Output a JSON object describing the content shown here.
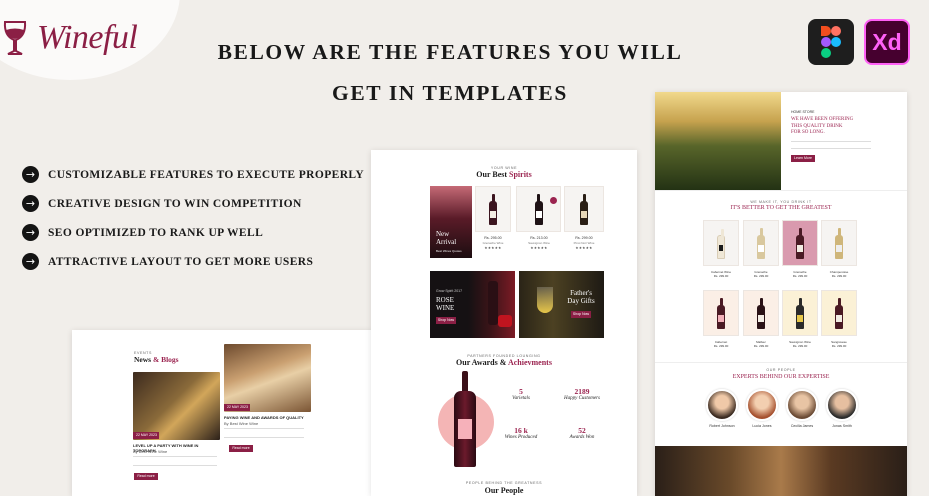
{
  "brand": {
    "name": "Wineful"
  },
  "headline": {
    "line1": "BELOW ARE THE FEATURES YOU WILL",
    "line2": "GET IN TEMPLATES"
  },
  "tools": [
    {
      "icon": "figma-icon"
    },
    {
      "label": "Xd",
      "icon": "adobe-xd-icon"
    }
  ],
  "features": [
    {
      "label": "CUSTOMIZABLE FEATURES TO EXECUTE PROPERLY"
    },
    {
      "label": "CREATIVE DESIGN TO WIN COMPETITION"
    },
    {
      "label": "SEO OPTIMIZED TO RANK UP WELL"
    },
    {
      "label": "ATTRACTIVE LAYOUT TO GET MORE USERS"
    }
  ],
  "colors": {
    "accent": "#8b1f45",
    "background": "#f1eeea",
    "xd_bg": "#46002f",
    "xd_fg": "#ff61f6"
  },
  "left_card": {
    "eyebrow": "EVENTS",
    "title_plain": "News ",
    "title_accent": "& Blogs",
    "blog1": {
      "date": "22 MAY 2023",
      "title": "LEVEL UP A PARTY WITH WINE IN TOPGRAPH",
      "meta": "By Best Wine Wine",
      "btn": "Read more"
    },
    "blog2": {
      "date": "22 MAY 2023",
      "title": "PAYING WINE AND AWARDS OF QUALITY",
      "meta": "By Best Wine Wine",
      "btn": "Read more"
    }
  },
  "center_card": {
    "eyebrow": "YOUR WINE",
    "title_plain": "Our Best ",
    "title_accent": "Spirits",
    "promo": {
      "line1": "New",
      "line2": "Arrival",
      "sub": "Best Wines Quotes"
    },
    "products": [
      {
        "price": "Rs. 295.00",
        "name": "Grenache Wine",
        "stars": "★★★★★"
      },
      {
        "price": "Rs. 213.00",
        "name": "Sauvignon Wine",
        "stars": "★★★★★"
      },
      {
        "price": "Rs. 299.00",
        "name": "Pinot Noir Wine",
        "stars": "★★★★★"
      }
    ],
    "banner1": {
      "eyebrow": "Grow Spirit 2017",
      "line1": "ROSE",
      "line2": "WINE",
      "btn": "Shop Now"
    },
    "banner2": {
      "line1": "Father's",
      "line2": "Day Gifts",
      "btn": "Shop Now"
    },
    "awards": {
      "eyebrow": "PARTNERS FOUNDED LOUNGING",
      "title_plain": "Our Awards & ",
      "title_accent": "Achievments",
      "stats": [
        {
          "num": "5",
          "label": "Varietals"
        },
        {
          "num": "2189",
          "label": "Happy Customers"
        },
        {
          "num": "16 k",
          "label": "Wines Produced"
        },
        {
          "num": "52",
          "label": "Awards Won"
        }
      ]
    },
    "people": {
      "eyebrow": "PEOPLE BEHIND THE GREATNESS",
      "title": "Our People"
    }
  },
  "right_card": {
    "hero": {
      "eyebrow": "HOME STORE",
      "line1": "WE HAVE BEEN OFFERING",
      "line2": "THIS QUALITY DRINK",
      "line3": "FOR SO LONG.",
      "btn": "Learn More"
    },
    "section": {
      "eyebrow": "WE MAKE IT, YOU DRINK IT",
      "title": "IT'S BETTER TO GET THE GREATEST"
    },
    "products_row1": [
      {
        "name": "Cabernet Wine",
        "price": "Rs. 299.00",
        "stars": "★★★★★"
      },
      {
        "name": "Grenache",
        "price": "Rs. 299.00",
        "stars": "★★★★★"
      },
      {
        "name": "Grenache",
        "price": "Rs. 299.00",
        "stars": "★★★★★"
      },
      {
        "name": "Champenoise",
        "price": "Rs. 299.00",
        "stars": "★★★★★"
      }
    ],
    "products_row2": [
      {
        "name": "Cabernet",
        "price": "Rs. 299.00",
        "stars": "★★★★★"
      },
      {
        "name": "Malbec",
        "price": "Rs. 299.00",
        "stars": "★★★★★"
      },
      {
        "name": "Sauvignon Wine",
        "price": "Rs. 299.00",
        "stars": "★★★★★"
      },
      {
        "name": "Sangiovese",
        "price": "Rs. 299.00",
        "stars": "★★★★★"
      }
    ],
    "experts_eyebrow": "OUR PEOPLE",
    "experts_title": "EXPERTS BEHIND OUR EXPERTISE",
    "experts": [
      {
        "name": "Robert Johnson"
      },
      {
        "name": "Lucia Jones"
      },
      {
        "name": "Cecilia James"
      },
      {
        "name": "Jonas Smith"
      }
    ]
  }
}
